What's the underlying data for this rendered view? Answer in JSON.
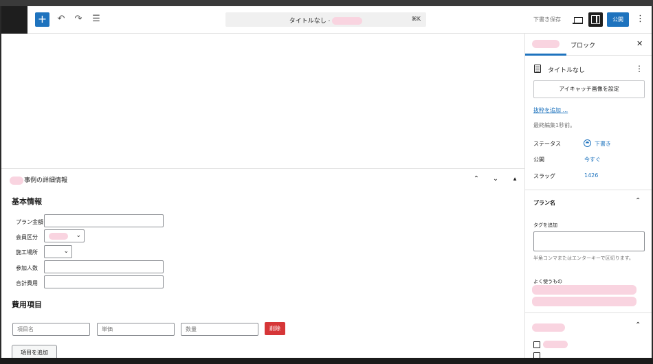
{
  "header": {
    "add_block": "+",
    "undo_icon": "↶",
    "redo_icon": "↷",
    "list_view_icon": "☰",
    "command_title": "タイトルなし ·",
    "command_shortcut": "⌘K",
    "draft_save": "下書き保存",
    "publish": "公開",
    "more": "⋮"
  },
  "metabox": {
    "title_suffix": "事例の詳細情報",
    "up": "⌃",
    "down": "⌄",
    "toggle": "▲",
    "basic_info_heading": "基本情報",
    "fields": [
      {
        "label": "プラン金額"
      },
      {
        "label": "会員区分"
      },
      {
        "label": "施工場所"
      },
      {
        "label": "参加人数"
      },
      {
        "label": "合計費用"
      }
    ],
    "cost_heading": "費用項目",
    "cost_item": {
      "name_placeholder": "項目名",
      "unit_price_placeholder": "単価",
      "quantity_placeholder": "数量",
      "delete": "削除"
    },
    "add_item": "項目を追加"
  },
  "sidebar": {
    "tab_block": "ブロック",
    "close": "✕",
    "post_title": "タイトルなし",
    "featured_image_button": "アイキャッチ画像を設定",
    "add_excerpt": "抜粋を追加 ...",
    "last_edited": "最終編集1秒前。",
    "rows": [
      {
        "label": "ステータス",
        "value": "下書き"
      },
      {
        "label": "公開",
        "value": "今すぐ"
      },
      {
        "label": "スラッグ",
        "value": "1426"
      }
    ],
    "plan_panel": {
      "title": "プラン名",
      "tag_label": "タグを追加",
      "help": "半角コンマまたはエンターキーで区切ります。",
      "frequent": "よく使うもの"
    }
  },
  "colors": {
    "accent": "#1e73be",
    "danger": "#d63638",
    "redacted": "#f9d4e0"
  }
}
